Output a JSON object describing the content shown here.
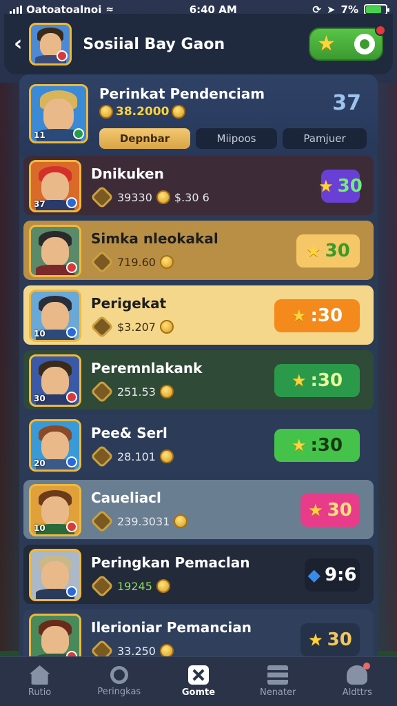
{
  "status_bar": {
    "carrier": "Oatoatoalnoi",
    "time": "6:40 AM",
    "battery_pct": "7%",
    "battery_level": 0.8,
    "battery_color": "#47d14f"
  },
  "header": {
    "title": "Sosiial Bay Gaon",
    "back_icon": "chevron-left-icon",
    "action_icons": [
      "star-icon",
      "gear-icon"
    ],
    "has_notification": true
  },
  "profile": {
    "name": "Perinkat Pendenciam",
    "level": "11",
    "score": "38.2000",
    "rank": "37",
    "tabs": [
      {
        "label": "Depnbar",
        "active": true
      },
      {
        "label": "Miipoos",
        "active": false
      },
      {
        "label": "Pamjuer",
        "active": false
      }
    ]
  },
  "leaderboard": [
    {
      "name": "Dnikuken",
      "level": "37",
      "meta_primary": "39330",
      "meta_secondary": "$.30 6",
      "score": "30",
      "score_bg": "#6a3fd6",
      "row_bg": "#3d2c37",
      "score_color": "#6ef07a",
      "avatar_hair": "#d4302a",
      "avatar_shirt": "#2a3a6a",
      "avatar_bg": "#d96a2a"
    },
    {
      "name": "Simka nleokakal",
      "level": "",
      "meta_primary": "719.60",
      "meta_secondary": "",
      "score": "30",
      "score_bg": "#f5c766",
      "row_bg": "#b98f46",
      "score_color": "#3a9a2a",
      "avatar_hair": "#2a2a2a",
      "avatar_shirt": "#7a2a2a",
      "avatar_bg": "#5a8a6a"
    },
    {
      "name": "Perigekat",
      "level": "10",
      "meta_primary": "$3.207",
      "meta_secondary": "",
      "score": ":30",
      "score_bg": "#f58a1c",
      "row_bg": "#f4d78a",
      "score_color": "#ffffff",
      "avatar_hair": "#2a2e3a",
      "avatar_shirt": "#2c4a7a",
      "avatar_bg": "#6aa8d8"
    },
    {
      "name": "Peremnlakank",
      "level": "30",
      "meta_primary": "251.53",
      "meta_secondary": "",
      "score": ":30",
      "score_bg": "#2a9a4a",
      "row_bg": "#2f4a36",
      "score_color": "#e6ff9a",
      "avatar_hair": "#3a2a1a",
      "avatar_shirt": "#2a3a6a",
      "avatar_bg": "#3a5aa8"
    },
    {
      "name": "Pee& Serl",
      "level": "20",
      "meta_primary": "28.101",
      "meta_secondary": "",
      "score": ":30",
      "score_bg": "#45c24a",
      "row_bg": "#2c3c58",
      "score_color": "#173a12",
      "avatar_hair": "#8a4a2a",
      "avatar_shirt": "#3a5a8a",
      "avatar_bg": "#3a9ad8"
    },
    {
      "name": "Caueliacl",
      "level": "10",
      "meta_primary": "239.3031",
      "meta_secondary": "",
      "score": "30",
      "score_bg": "#e83c8a",
      "row_bg": "#6a7e92",
      "score_color": "#ffe07a",
      "avatar_hair": "#6a3a1a",
      "avatar_shirt": "#2a6a3a",
      "avatar_bg": "#e0a03a"
    },
    {
      "name": "Peringkan Pemaclan",
      "level": "",
      "meta_primary": "19245",
      "meta_secondary": "",
      "score": "9:6",
      "score_bg": "#1c2130",
      "row_bg": "#232a3a",
      "score_color": "#ffffff",
      "avatar_hair": "#c8b88a",
      "avatar_shirt": "#2a3a5a",
      "avatar_bg": "#aab8c8"
    },
    {
      "name": "Ilerioniar Pemancian",
      "level": "",
      "meta_primary": "33.250",
      "meta_secondary": "",
      "score": "30",
      "score_bg": "#25324a",
      "row_bg": "#2f3f5c",
      "score_color": "#f2c65a",
      "avatar_hair": "#6a2a1a",
      "avatar_shirt": "#2a5a3a",
      "avatar_bg": "#4a8a5a"
    }
  ],
  "nav": [
    {
      "label": "Rutio",
      "icon": "home-icon",
      "active": false
    },
    {
      "label": "Peringkas",
      "icon": "search-icon",
      "active": false
    },
    {
      "label": "Gomte",
      "icon": "close-icon",
      "active": true
    },
    {
      "label": "Nenater",
      "icon": "menu-icon",
      "active": false
    },
    {
      "label": "Aldttrs",
      "icon": "user-icon",
      "active": false
    }
  ]
}
